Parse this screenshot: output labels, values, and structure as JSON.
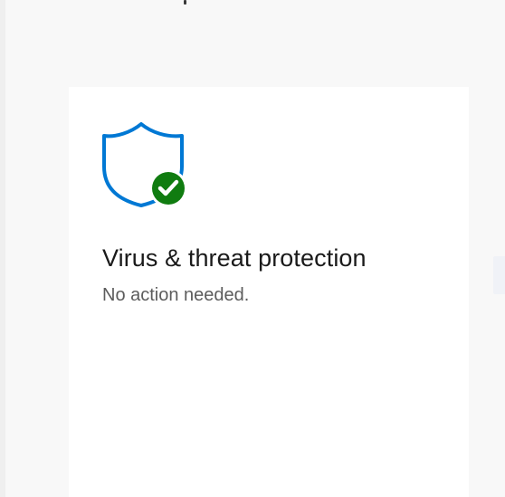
{
  "card": {
    "title": "Virus & threat protection",
    "status": "No action needed.",
    "icon": "shield-check-icon",
    "badge_icon": "check-icon"
  },
  "colors": {
    "shield_stroke": "#0078d4",
    "badge_fill": "#107c10",
    "title_text": "#1a1a1a",
    "subtitle_text": "#5c5c5c",
    "page_background": "#f8f8f8",
    "card_background": "#ffffff"
  }
}
